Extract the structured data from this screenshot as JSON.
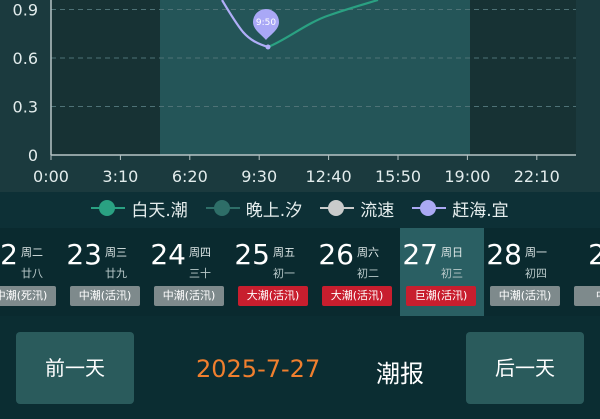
{
  "chart": {
    "y_ticks": [
      "0",
      "0.3",
      "0.6",
      "0.9"
    ],
    "x_ticks": [
      "0:00",
      "3:10",
      "6:20",
      "9:30",
      "12:40",
      "15:50",
      "19:00",
      "22:10"
    ],
    "marker_label": "9:50",
    "colors": {
      "tide": "#2aa182",
      "curve": "#b0aef8",
      "marker": "#a9a8f6",
      "shade": "#245558"
    }
  },
  "legend": [
    {
      "label": "白天.潮",
      "color": "#2aa182"
    },
    {
      "label": "晚上.汐",
      "color": "#2e6e68"
    },
    {
      "label": "流速",
      "color": "#c9cbcb"
    },
    {
      "label": "赶海.宜",
      "color": "#aaa9f4"
    }
  ],
  "days": [
    {
      "num": "22",
      "week": "周二",
      "lunar": "廿八",
      "tide": "中潮(死汛)",
      "level": "mid"
    },
    {
      "num": "23",
      "week": "周三",
      "lunar": "廿九",
      "tide": "中潮(活汛)",
      "level": "mid"
    },
    {
      "num": "24",
      "week": "周四",
      "lunar": "三十",
      "tide": "中潮(活汛)",
      "level": "mid"
    },
    {
      "num": "25",
      "week": "周五",
      "lunar": "初一",
      "tide": "大潮(活汛)",
      "level": "big"
    },
    {
      "num": "26",
      "week": "周六",
      "lunar": "初二",
      "tide": "大潮(活汛)",
      "level": "big"
    },
    {
      "num": "27",
      "week": "周日",
      "lunar": "初三",
      "tide": "巨潮(活汛)",
      "level": "big",
      "selected": true
    },
    {
      "num": "28",
      "week": "周一",
      "lunar": "初四",
      "tide": "中潮(活汛)",
      "level": "mid"
    },
    {
      "num": "2",
      "week": "",
      "lunar": "",
      "tide": "中潮(",
      "level": "mid"
    }
  ],
  "bottom": {
    "prev_label": "前一天",
    "date": "2025-7-27",
    "report_label": "潮报",
    "next_label": "后一天"
  }
}
